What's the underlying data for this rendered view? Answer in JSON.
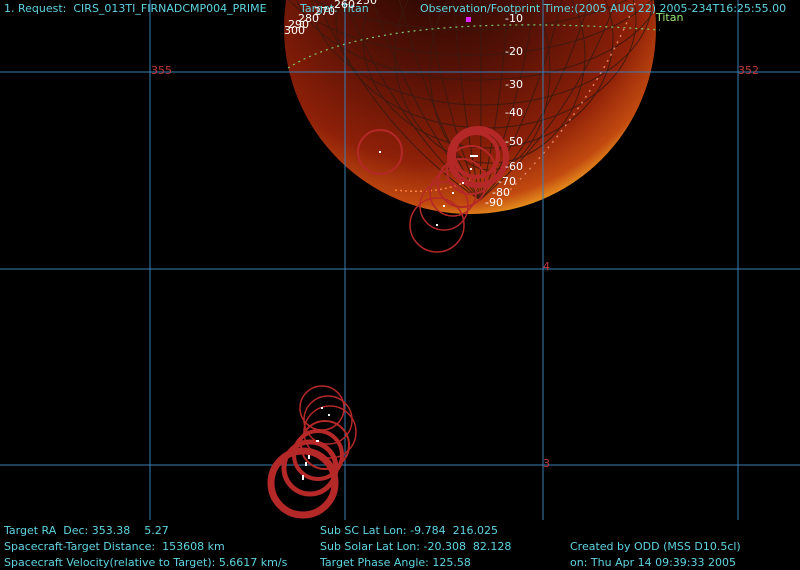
{
  "header": {
    "request": "1. Request:  CIRS_013TI_FIRNADCMP004_PRIME",
    "target": "Target: Titan",
    "obs_time": "Observation/Footprint Time:(2005 AUG 22) 2005-234T16:25:55.00",
    "target_name": "Titan"
  },
  "grid_labels": {
    "ra_355": "355",
    "ra_352": "352",
    "dec_4": "4",
    "dec_3": "3"
  },
  "latitude_labels": [
    "-10",
    "-20",
    "-30",
    "-40",
    "-50",
    "-60",
    "-70",
    "-80",
    "-90"
  ],
  "longitude_labels": [
    "300",
    "290",
    "280",
    "270",
    "260",
    "250"
  ],
  "footer": {
    "target_ra_dec": "Target RA  Dec: 353.38    5.27",
    "distance": "Spacecraft-Target Distance:  153608 km",
    "velocity": "Spacecraft Velocity(relative to Target): 5.6617 km/s",
    "sub_sc": "Sub SC Lat Lon: -9.784  216.025",
    "sub_solar": "Sub Solar Lat Lon: -20.308  82.128",
    "phase_angle": "Target Phase Angle: 125.58",
    "created_by": "Created by ODD (MSS D10.5cl)",
    "created_on": "on: Thu Apr 14 09:39:33 2005"
  },
  "colors": {
    "grid": "#3a7fb5",
    "planet": "#8a1a08",
    "footprint": "#b42828",
    "text": "#5fd4e0"
  }
}
